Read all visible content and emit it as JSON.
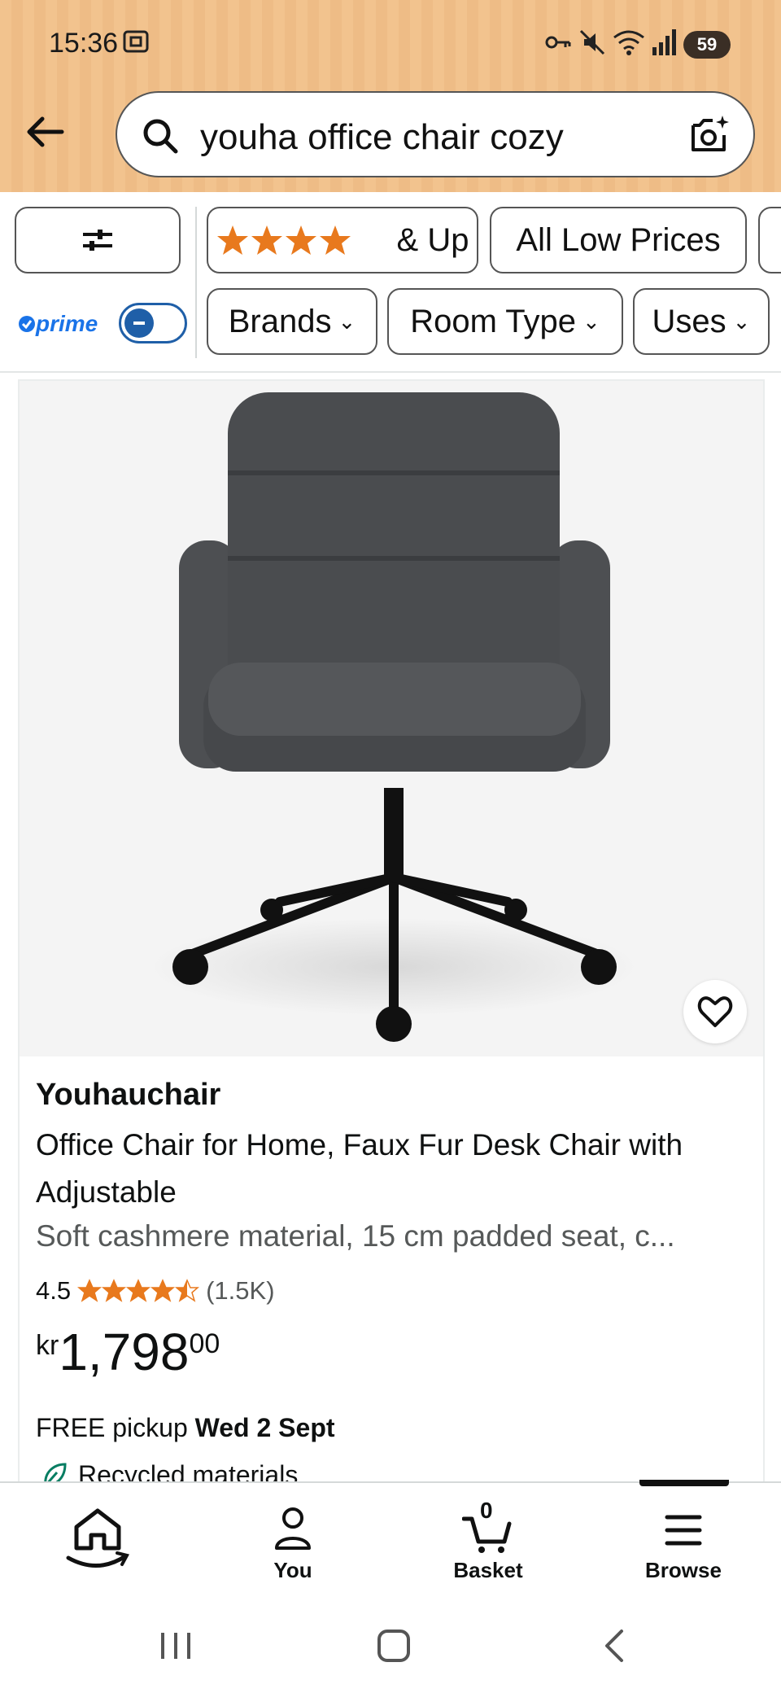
{
  "status_bar": {
    "time": "15:36",
    "battery": "59"
  },
  "search": {
    "query": "youha office chair cozy"
  },
  "filters": {
    "rating_chip": "& Up",
    "low_prices_chip": "All Low Prices",
    "brands_chip": "Brands",
    "room_type_chip": "Room Type",
    "uses_chip": "Uses",
    "prime_label": "prime",
    "prime_toggle_on": false
  },
  "product": {
    "brand": "Youhauchair",
    "title": "Office Chair for Home, Faux Fur Desk Chair with Adjustable",
    "subtitle": "Soft cashmere material, 15 cm padded seat, c...",
    "rating": "4.5",
    "rating_stars": 4.5,
    "rating_count": "(1.5K)",
    "price_currency": "kr",
    "price_whole": "1,798",
    "price_fraction": "00",
    "delivery_prefix": "FREE pickup",
    "delivery_date": "Wed 2 Sept",
    "badge": "Recycled materials"
  },
  "bottom_nav": {
    "you": "You",
    "basket": "Basket",
    "basket_count": "0",
    "browse": "Browse"
  },
  "colors": {
    "header_bg": "#f2c38e",
    "star": "#e8791d",
    "prime_blue": "#1a73e8",
    "recycled_green": "#067d62"
  }
}
